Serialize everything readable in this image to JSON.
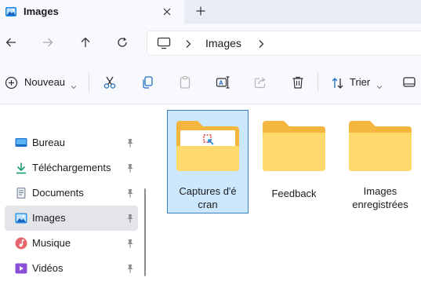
{
  "window": {
    "tab_title": "Images",
    "tab_close_icon": "close-icon",
    "new_tab_icon": "plus-icon"
  },
  "nav": {
    "back_icon": "arrow-left-icon",
    "forward_icon": "arrow-right-icon",
    "up_icon": "arrow-up-icon",
    "refresh_icon": "refresh-icon",
    "address": {
      "root_icon": "computer-icon",
      "segments": [
        "Images"
      ]
    }
  },
  "commandbar": {
    "new_label": "Nouveau",
    "sort_label": "Trier",
    "icons": [
      "plus-circle-icon",
      "cut-icon",
      "copy-icon",
      "paste-icon",
      "rename-icon",
      "share-icon",
      "delete-icon",
      "sort-icon",
      "view-icon"
    ]
  },
  "sidebar": {
    "items": [
      {
        "label": "Bureau",
        "icon": "desktop-icon",
        "pinned": true,
        "selected": false
      },
      {
        "label": "Téléchargements",
        "icon": "download-icon",
        "pinned": true,
        "selected": false
      },
      {
        "label": "Documents",
        "icon": "documents-icon",
        "pinned": true,
        "selected": false
      },
      {
        "label": "Images",
        "icon": "pictures-icon",
        "pinned": true,
        "selected": true
      },
      {
        "label": "Musique",
        "icon": "music-icon",
        "pinned": true,
        "selected": false
      },
      {
        "label": "Vidéos",
        "icon": "videos-icon",
        "pinned": true,
        "selected": false
      }
    ]
  },
  "content": {
    "folders": [
      {
        "label_lines": [
          "Captures d'é",
          "cran"
        ],
        "icon": "folder-screenshots-icon",
        "selected": true
      },
      {
        "label_lines": [
          "Feedback"
        ],
        "icon": "folder-icon",
        "selected": false
      },
      {
        "label_lines": [
          "Images",
          "enregistrées"
        ],
        "icon": "folder-icon",
        "selected": false
      }
    ]
  },
  "colors": {
    "accent": "#0067c0",
    "folder_body": "#ffd96b",
    "folder_back": "#f4b63f",
    "selection_fill": "#cce8ff",
    "selection_border": "#3a7fc4",
    "sidebar_selected": "#e3e5e9"
  }
}
